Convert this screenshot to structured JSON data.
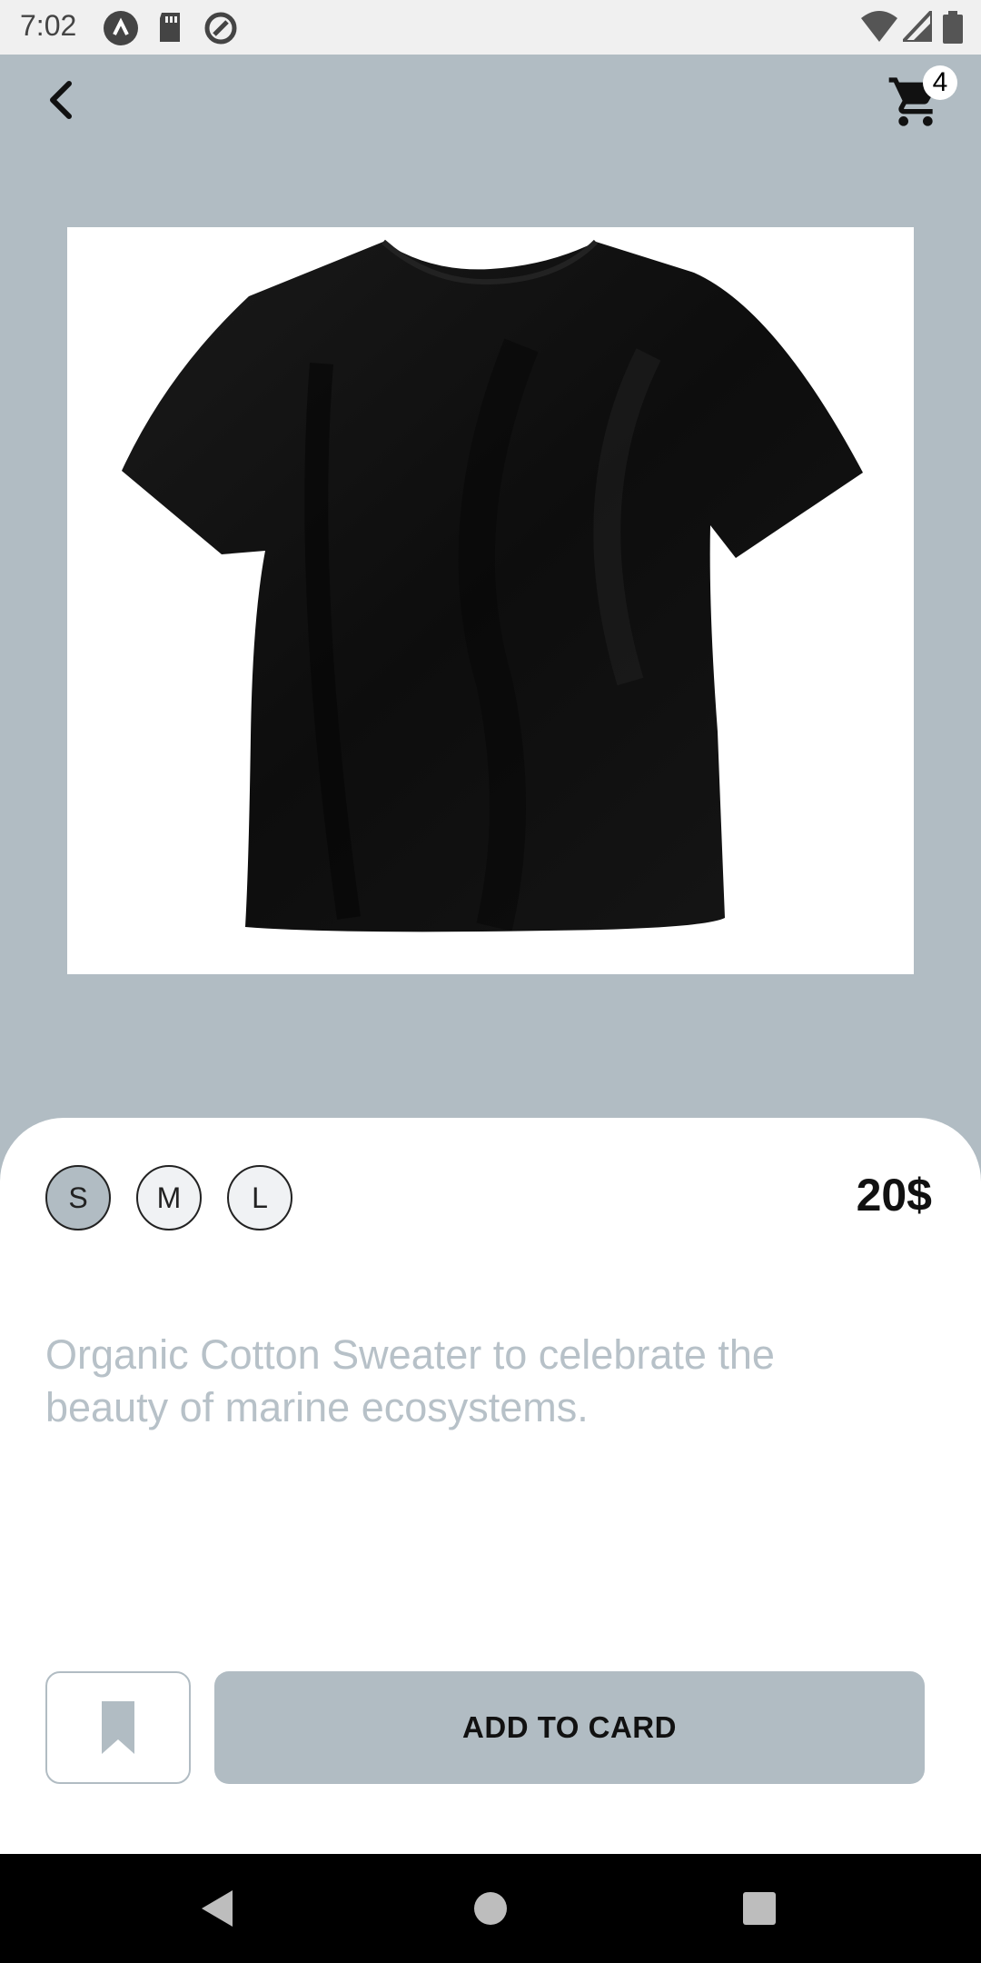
{
  "status_bar": {
    "time": "7:02"
  },
  "top_bar": {
    "back_icon": "chevron-left-icon",
    "cart_icon": "shopping-cart-icon",
    "cart_count": "4"
  },
  "product": {
    "image_alt": "black t-shirt",
    "sizes": [
      "S",
      "M",
      "L"
    ],
    "selected_size": "S",
    "price": "20$",
    "description": "Organic Cotton Sweater to celebrate the beauty of marine ecosystems."
  },
  "actions": {
    "bookmark_icon": "bookmark-icon",
    "add_label": "ADD TO CARD"
  },
  "colors": {
    "accent": "#b1bcc3",
    "description_text": "#b7c1c8"
  }
}
